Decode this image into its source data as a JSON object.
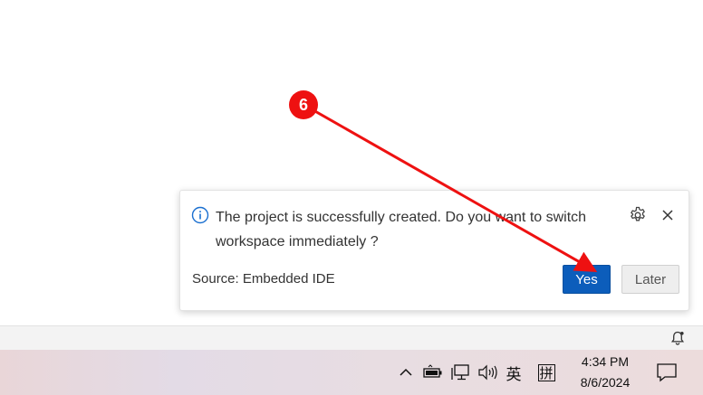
{
  "notification": {
    "message": "The project is successfully created. Do you want to switch workspace immediately ?",
    "source": "Source: Embedded IDE",
    "yes_label": "Yes",
    "later_label": "Later"
  },
  "taskbar": {
    "ime_lang": "英",
    "ime_mode": "拼",
    "time": "4:34 PM",
    "date": "8/6/2024"
  },
  "annotation": {
    "step_number": "6",
    "color": "#ee1111"
  },
  "colors": {
    "primary_button": "#0c5dbb",
    "info_icon": "#1a6fd0"
  }
}
